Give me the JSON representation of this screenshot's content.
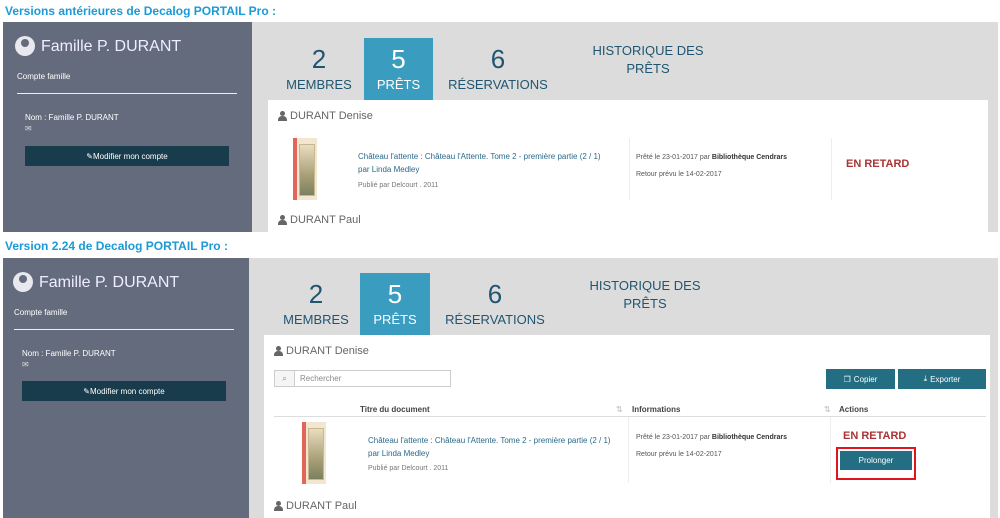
{
  "headings": {
    "old": "Versions antérieures de Decalog PORTAIL Pro :",
    "new": "Version 2.24 de Decalog PORTAIL Pro :"
  },
  "account": {
    "name": "Famille P. DURANT",
    "type": "Compte famille",
    "nom": "Nom : Famille P. DURANT",
    "modify": "Modifier mon compte"
  },
  "tabs": [
    {
      "n": "2",
      "label": "MEMBRES"
    },
    {
      "n": "5",
      "label": "PRÊTS"
    },
    {
      "n": "6",
      "label": "RÉSERVATIONS"
    },
    {
      "n": "",
      "label": "HISTORIQUE DES PRÊTS"
    }
  ],
  "members": [
    "DURANT Denise",
    "DURANT Paul"
  ],
  "loan": {
    "title": "Château l'attente : Château l'Attente. Tome 2 - première partie (2 / 1)",
    "author": "par Linda Medley",
    "publisher": "Publié par Delcourt . 2011",
    "lent_prefix": "Prêté le 23-01-2017 par",
    "library": "Bibliothèque Cendrars",
    "return": "Retour prévu le 14-02-2017",
    "status": "EN RETARD"
  },
  "table": {
    "search_placeholder": "Rechercher",
    "copy": "Copier",
    "export": "Exporter",
    "col_title": "Titre du document",
    "col_info": "Informations",
    "col_actions": "Actions",
    "renew": "Prolonger"
  }
}
